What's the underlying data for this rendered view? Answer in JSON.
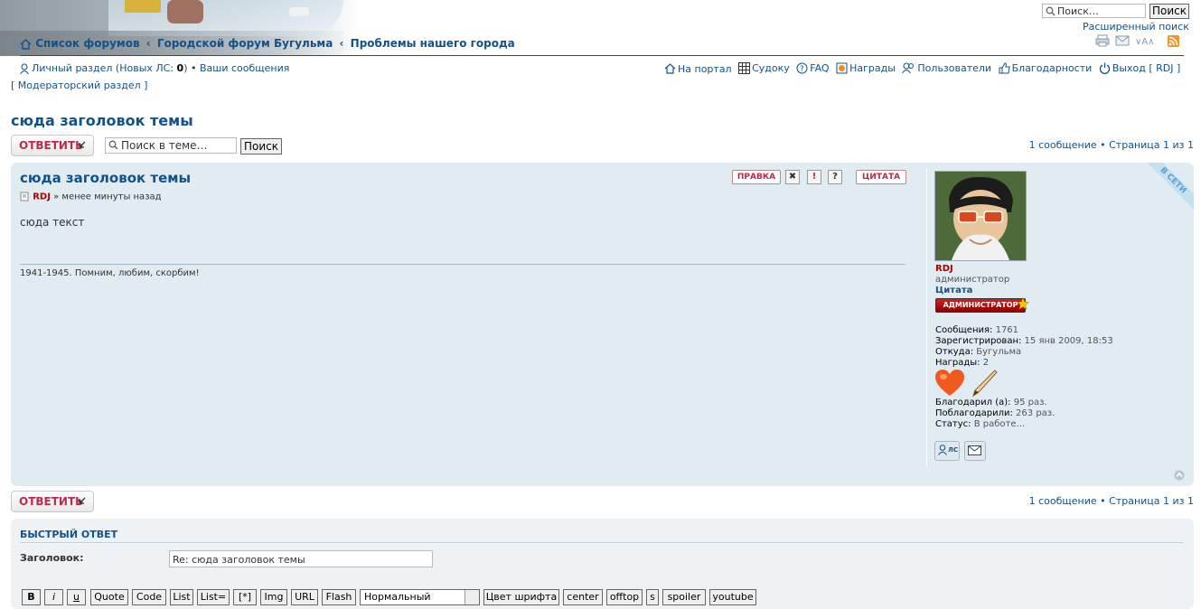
{
  "header": {
    "breadcrumbs": [
      "Список форумов",
      "Городской форум Бугульма",
      "Проблемы нашего города"
    ],
    "crumb_sep": "‹",
    "search_placeholder": "Поиск…",
    "search_button": "Поиск",
    "advanced_search": "Расширенный поиск"
  },
  "nav_left": {
    "personal": "Личный раздел (Новых ЛС: ",
    "new_pm_count": "0",
    "personal_close": ")",
    "bullet": "•",
    "your_posts": "Ваши сообщения",
    "moderator": "[ Модераторский раздел ]"
  },
  "nav_right": {
    "portal": "На портал",
    "sudoku": "Судоку",
    "faq": "FAQ",
    "awards": "Награды",
    "users": "Пользователи",
    "thanks": "Благодарности",
    "logout": "Выход [ RDJ ]"
  },
  "topic": {
    "title": "сюда заголовок темы",
    "reply_label": "ОТВЕТИТЬ",
    "search_placeholder": "Поиск в теме…",
    "search_button": "Поиск",
    "pagination": "1 сообщение • Страница 1 из 1"
  },
  "post": {
    "title": "сюда заголовок темы",
    "author": "RDJ",
    "time": "» менее минуты назад",
    "body": "сюда текст",
    "signature": "1941-1945. Помним, любим, скорбим!",
    "buttons": {
      "edit": "ПРАВКА",
      "delete": "✖",
      "report": "!",
      "info": "?",
      "quote": "ЦИТАТА"
    },
    "online": "В СЕТИ"
  },
  "profile": {
    "username": "RDJ",
    "rank": "администратор",
    "rank2": "Цитата",
    "rank_image": "АДМИНИСТРАТОР",
    "posts_label": "Сообщения:",
    "posts": "1761",
    "registered_label": "Зарегистрирован:",
    "registered": "15 янв 2009, 18:53",
    "from_label": "Откуда:",
    "from": "Бугульма",
    "awards_label": "Награды:",
    "awards": "2",
    "thanked_label": "Благодарил (а):",
    "thanked": "95 раз.",
    "was_thanked_label": "Поблагодарили:",
    "was_thanked": "263 раз.",
    "status_label": "Статус:",
    "status": "В работе...",
    "pm_label": "ЛС"
  },
  "quick_reply": {
    "title": "БЫСТРЫЙ ОТВЕТ",
    "subject_label": "Заголовок:",
    "subject_value": "Re: сюда заголовок темы",
    "bbcodes": [
      "B",
      "i",
      "u",
      "Quote",
      "Code",
      "List",
      "List=",
      "[*]",
      "Img",
      "URL",
      "Flash"
    ],
    "font_size": "Нормальный",
    "bbcodes2": [
      "Цвет шрифта",
      "center",
      "offtop",
      "s",
      "spoiler",
      "youtube"
    ]
  },
  "colors": {
    "link": "#105289",
    "red": "#BC2A4D",
    "post_bg": "#e1ebf2"
  }
}
